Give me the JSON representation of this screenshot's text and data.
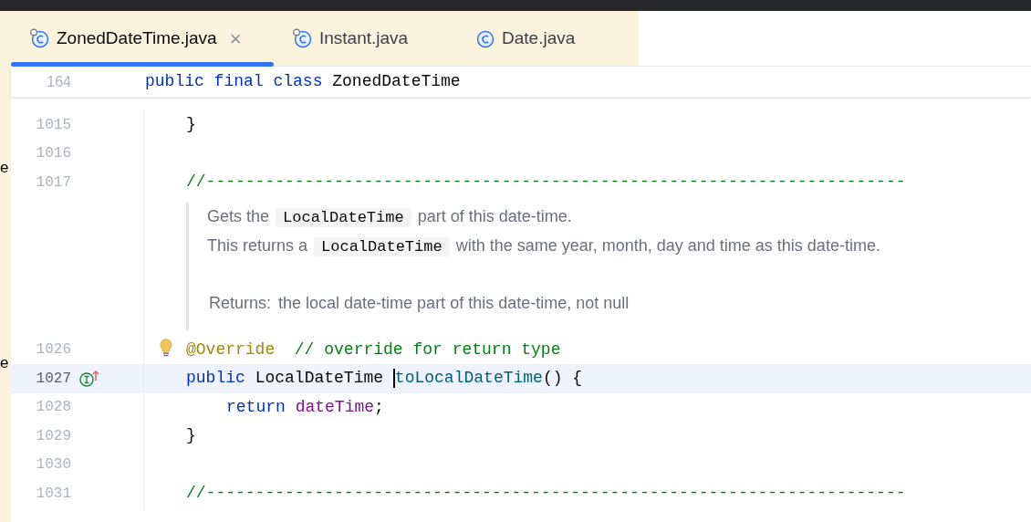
{
  "tabs": [
    {
      "label": "ZonedDateTime.java",
      "selected": true,
      "closable": true,
      "pinned": true
    },
    {
      "label": "Instant.java",
      "selected": false,
      "closable": false,
      "pinned": true
    },
    {
      "label": "Date.java",
      "selected": false,
      "closable": false,
      "pinned": false
    }
  ],
  "close_glyph": "×",
  "side_fragments": [
    "e",
    "e"
  ],
  "sticky_header": {
    "number": "164",
    "tokens": [
      {
        "text": "public final class ",
        "kind": "keyword"
      },
      {
        "text": "ZonedDateTime",
        "kind": "plain"
      }
    ]
  },
  "lines": [
    {
      "kind": "code",
      "number": "1015",
      "current": false,
      "tokens": [
        {
          "text": "}",
          "kind": "plain"
        }
      ]
    },
    {
      "kind": "code",
      "number": "1016",
      "current": false
    },
    {
      "kind": "code",
      "number": "1017",
      "current": false,
      "tokens": [
        {
          "text": "//-----------------------------------------------------------------------",
          "kind": "comment"
        }
      ]
    },
    {
      "kind": "doc",
      "paragraphs": [
        [
          {
            "text": "Gets the ",
            "code": false
          },
          {
            "text": "LocalDateTime",
            "code": true
          },
          {
            "text": " part of this date-time.",
            "code": false
          }
        ],
        [
          {
            "text": "This returns a ",
            "code": false
          },
          {
            "text": "LocalDateTime",
            "code": true
          },
          {
            "text": " with the same year, month, day and time as this date-time.",
            "code": false
          }
        ]
      ],
      "returns_label": "Returns:",
      "returns_text": "the local date-time part of this date-time, not null"
    },
    {
      "kind": "code",
      "number": "1026",
      "current": false,
      "bulb": true,
      "tokens": [
        {
          "text": "@Override",
          "kind": "annotation"
        },
        {
          "text": "  // override for return type",
          "kind": "comment"
        }
      ]
    },
    {
      "kind": "code",
      "number": "1027",
      "current": true,
      "implements_marker": true,
      "tokens": [
        {
          "text": "public ",
          "kind": "keyword"
        },
        {
          "text": "LocalDateTime ",
          "kind": "plain"
        },
        {
          "text": "toLocalDateTime",
          "kind": "method",
          "caret": true
        },
        {
          "text": "() {",
          "kind": "plain"
        }
      ],
      "children": [
        {
          "kind": "code",
          "number": "1028",
          "current": false,
          "tokens": [
            {
              "text": "return ",
              "kind": "keyword"
            },
            {
              "text": "dateTime",
              "kind": "field"
            },
            {
              "text": ";",
              "kind": "plain"
            }
          ]
        }
      ]
    },
    {
      "kind": "code",
      "number": "1029",
      "current": false,
      "tokens": [
        {
          "text": "}",
          "kind": "plain"
        }
      ]
    },
    {
      "kind": "code",
      "number": "1030",
      "current": false
    },
    {
      "kind": "code",
      "number": "1031",
      "current": false,
      "tokens": [
        {
          "text": "//-----------------------------------------------------------------------",
          "kind": "comment"
        }
      ]
    }
  ]
}
